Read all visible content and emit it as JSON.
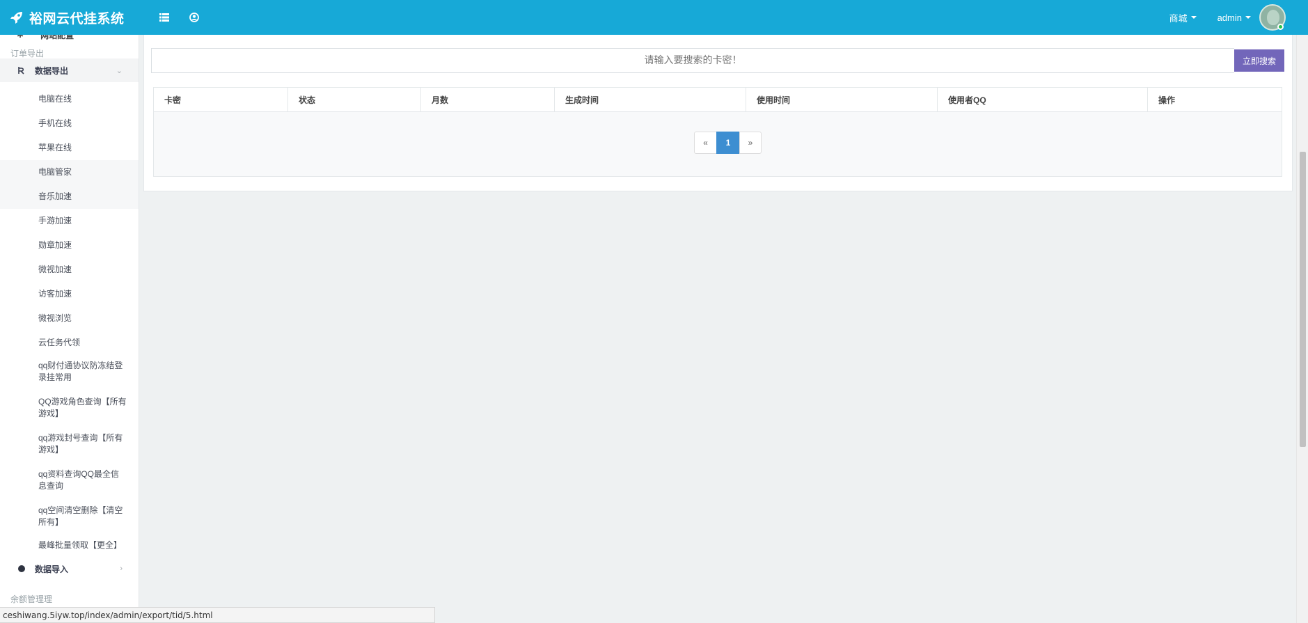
{
  "app": {
    "title": "裕网云代挂系统"
  },
  "topbar": {
    "mall_label": "商城",
    "user_label": "admin",
    "icons": [
      "menu-list-icon",
      "user-circle-icon"
    ]
  },
  "sidebar": {
    "cut_item_label": "网站配置",
    "section_order_export": "订单导出",
    "export_group": "数据导出",
    "items": [
      "电脑在线",
      "手机在线",
      "苹果在线",
      "电脑管家",
      "音乐加速",
      "手游加速",
      "勋章加速",
      "微视加速",
      "访客加速",
      "微视浏览",
      "云任务代领",
      "qq财付通协议防冻结登录挂常用",
      "QQ游戏角色查询【所有游戏】",
      "qq游戏封号查询【所有游戏】",
      "qq资料查询QQ最全信息查询",
      "qq空间清空删除【清空所有】",
      "最峰批量领取【更全】"
    ],
    "import_group": "数据导入",
    "section_balance": "余额管理理"
  },
  "main": {
    "search_placeholder": "请输入要搜索的卡密！",
    "search_button": "立即搜索",
    "columns": [
      "卡密",
      "状态",
      "月数",
      "生成时间",
      "使用时间",
      "使用者QQ",
      "操作"
    ],
    "pagination": {
      "prev": "«",
      "current": "1",
      "next": "»"
    }
  },
  "statusbar": {
    "url": "ceshiwang.5iyw.top/index/admin/export/tid/5.html"
  },
  "colors": {
    "topbar": "#17a9d7",
    "search_button": "#7266ba",
    "page_active": "#3d8ed1"
  }
}
